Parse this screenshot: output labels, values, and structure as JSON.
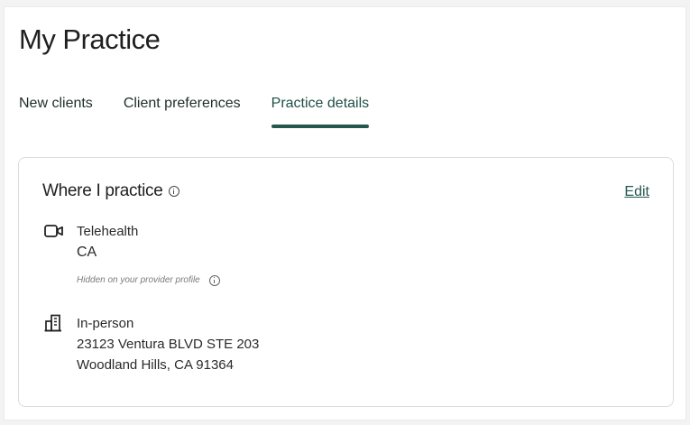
{
  "page": {
    "title": "My Practice"
  },
  "tabs": [
    {
      "label": "New clients",
      "active": false
    },
    {
      "label": "Client preferences",
      "active": false
    },
    {
      "label": "Practice details",
      "active": true
    }
  ],
  "card": {
    "title": "Where I practice",
    "title_icon": "info-icon",
    "edit_label": "Edit",
    "telehealth": {
      "icon": "video-camera-icon",
      "type": "Telehealth",
      "state": "CA",
      "note": "Hidden on your provider profile",
      "note_icon": "info-icon"
    },
    "in_person": {
      "icon": "building-icon",
      "type": "In-person",
      "address_line1": "23123 Ventura BLVD STE 203",
      "address_line2": "Woodland Hills, CA 91364"
    }
  },
  "colors": {
    "accent": "#24574d",
    "text": "#1f1f1f",
    "muted": "#7a7a7a",
    "border": "#dcdcdc"
  }
}
